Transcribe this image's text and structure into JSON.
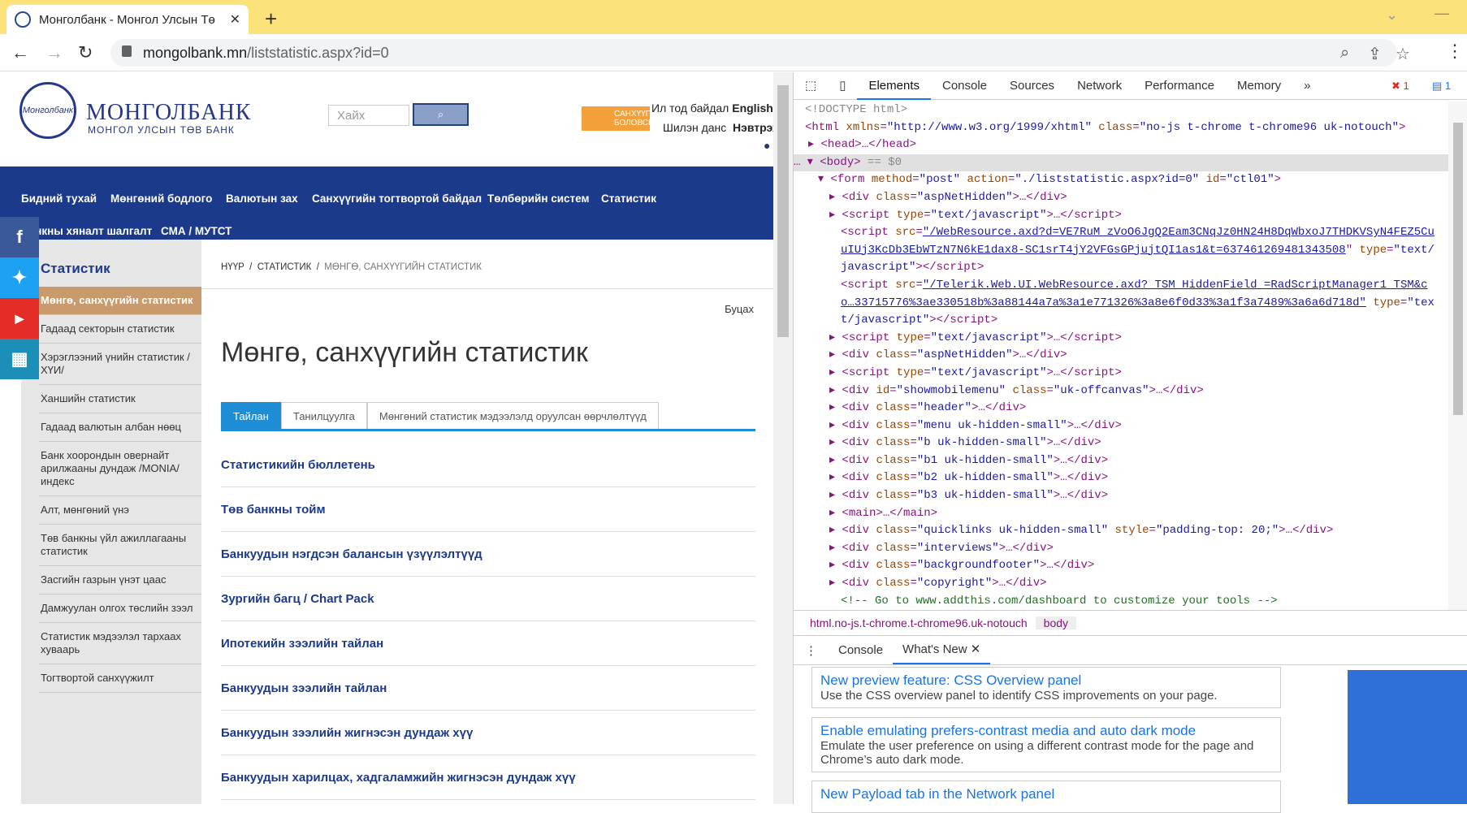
{
  "browser": {
    "tab_title": "Монголбанк - Монгол Улсын Тө",
    "url_host": "mongolbank.mn",
    "url_path": "/liststatistic.aspx?id=0"
  },
  "site": {
    "logo_title": "МОНГОЛБАНК",
    "logo_sub": "МОНГОЛ УЛСЫН ТӨВ БАНК",
    "logo_mark": "Монголбанк",
    "search_placeholder": "Хайх",
    "badge": "САНХҮҮГИЙН БОЛОВСРОЛ",
    "org_link": "Ил тод байдал",
    "lang": "English",
    "account": "Шилэн данс",
    "login": "Нэвтрэх",
    "menu": [
      "Бидний тухай",
      "Мөнгөний бодлого",
      "Валютын зах",
      "Санхүүгийн тогтвортой байдал",
      "Төлбөрийн систем",
      "Статистик",
      "Банкны хяналт шалгалт",
      "СМА / МУТСТ"
    ],
    "sidebar_title": "Статистик",
    "sidebar": [
      "Мөнгө, санхүүгийн статистик",
      "Гадаад секторын статистик",
      "Хэрэглээний үнийн статистик /ХҮИ/",
      "Ханшийн статистик",
      "Гадаад валютын албан нөөц",
      "Банк хоорондын овернайт арилжааны дундаж /MONIA/ индекс",
      "Алт, мөнгөний үнэ",
      "Төв банкны үйл ажиллагааны статистик",
      "Засгийн газрын үнэт цаас",
      "Дамжуулан олгох төслийн зээл",
      "Статистик мэдээлэл тархаах хуваарь",
      "Тогтвортой санхүүжилт"
    ],
    "crumb": [
      "НҮҮР",
      "СТАТИСТИК",
      "МӨНГӨ, САНХҮҮГИЙН СТАТИСТИК"
    ],
    "back": "Буцах",
    "heading": "Мөнгө, санхүүгийн статистик",
    "tabs": [
      "Тайлан",
      "Танилцуулга",
      "Мөнгөний статистик мэдээлэлд оруулсан өөрчлөлтүүд"
    ],
    "items": [
      "Статистикийн бюллетень",
      "Төв банкны тойм",
      "Банкуудын нэгдсэн балансын үзүүлэлтүүд",
      "Зургийн багц / Chart Pack",
      "Ипотекийн зээлийн тайлан",
      "Банкуудын зээлийн тайлан",
      "Банкуудын зээлийн жигнэсэн дундаж хүү",
      "Банкуудын харилцах, хадгаламжийн жигнэсэн дундаж хүү"
    ]
  },
  "devtools": {
    "tabs": [
      "Elements",
      "Console",
      "Sources",
      "Network",
      "Performance",
      "Memory"
    ],
    "errors": "1",
    "messages": "1",
    "breadcrumbs": [
      "html.no-js.t-chrome.t-chrome96.uk-notouch",
      "body"
    ],
    "drawer_tabs": [
      "Console",
      "What's New"
    ],
    "cards": [
      {
        "title": "New preview feature: CSS Overview panel",
        "desc": "Use the CSS overview panel to identify CSS improvements on your page."
      },
      {
        "title": "Enable emulating prefers-contrast media and auto dark mode",
        "desc": "Emulate the user preference on using a different contrast mode for the page and Chrome’s auto dark mode."
      },
      {
        "title": "New Payload tab in the Network panel",
        "desc": ""
      }
    ]
  }
}
